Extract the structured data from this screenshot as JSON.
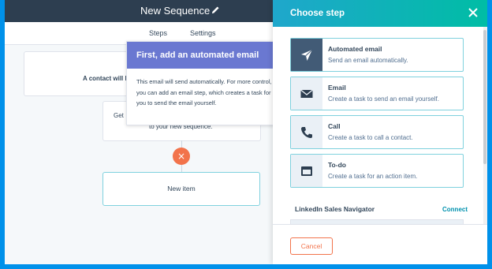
{
  "editor": {
    "title": "New Sequence",
    "tabs": [
      {
        "label": "Steps"
      },
      {
        "label": "Settings"
      }
    ],
    "cards": {
      "enroll_text": "A contact will b",
      "prompt_line1": "Get",
      "prompt_line2": "to your new sequence.",
      "new_item": "New item"
    },
    "remove_symbol": "×"
  },
  "tooltip": {
    "title": "First, add an automated email",
    "body": "This email will send automatically. For more control, you can add an email step, which creates a task for you to send the email yourself."
  },
  "panel": {
    "title": "Choose step",
    "steps": [
      {
        "name": "Automated email",
        "description": "Send an email automatically.",
        "icon": "paper-plane-icon",
        "selected": true
      },
      {
        "name": "Email",
        "description": "Create a task to send an email yourself.",
        "icon": "envelope-icon",
        "selected": false
      },
      {
        "name": "Call",
        "description": "Create a task to call a contact.",
        "icon": "phone-icon",
        "selected": false
      },
      {
        "name": "To-do",
        "description": "Create a task for an action item.",
        "icon": "task-icon",
        "selected": false
      }
    ],
    "linkedin": {
      "title": "LinkedIn Sales Navigator",
      "connect": "Connect"
    },
    "cancel": "Cancel"
  },
  "colors": {
    "frame": "#0091ea",
    "topbar": "#2d3e50",
    "tooltip_header": "#6a78d1",
    "accent_orange": "#f2734b",
    "teal_border": "#7fd1de",
    "link": "#0091ae"
  }
}
